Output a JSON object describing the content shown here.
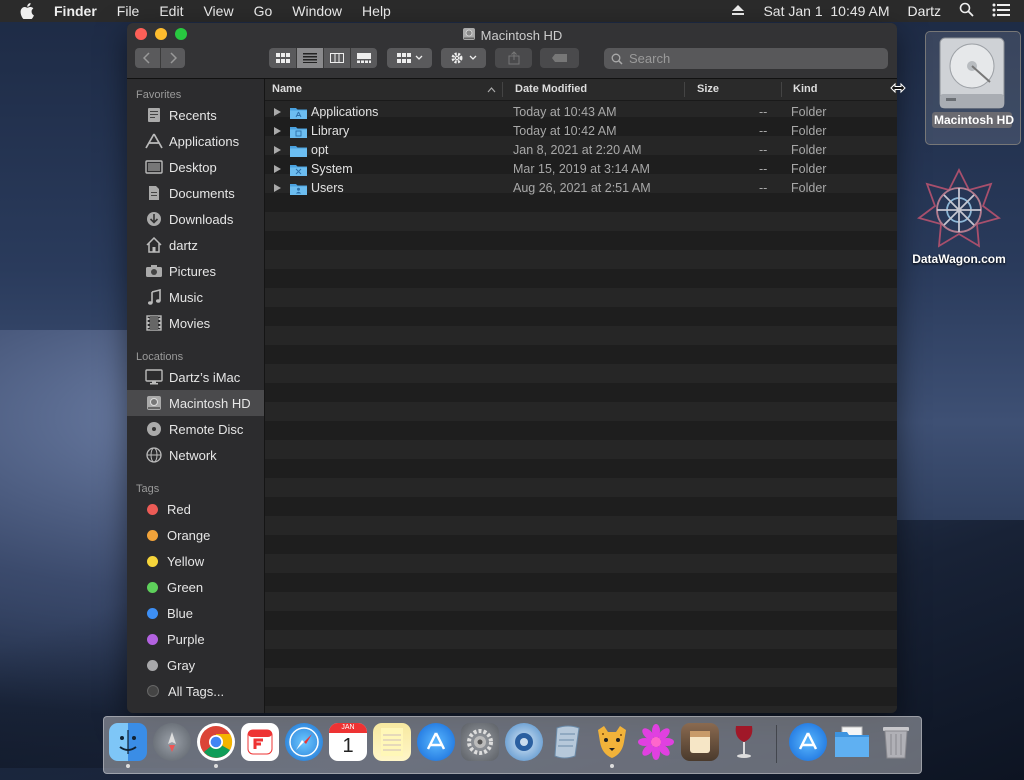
{
  "menubar": {
    "app_name": "Finder",
    "items": [
      "File",
      "Edit",
      "View",
      "Go",
      "Window",
      "Help"
    ],
    "datetime": "Sat Jan 1  10:49 AM",
    "user": "Dartz"
  },
  "window": {
    "title": "Macintosh HD",
    "search_placeholder": "Search"
  },
  "sidebar": {
    "favorites_header": "Favorites",
    "favorites": [
      {
        "label": "Recents",
        "icon": "clock-icon"
      },
      {
        "label": "Applications",
        "icon": "applications-icon"
      },
      {
        "label": "Desktop",
        "icon": "desktop-icon"
      },
      {
        "label": "Documents",
        "icon": "documents-icon"
      },
      {
        "label": "Downloads",
        "icon": "downloads-icon"
      },
      {
        "label": "dartz",
        "icon": "home-icon"
      },
      {
        "label": "Pictures",
        "icon": "camera-icon"
      },
      {
        "label": "Music",
        "icon": "music-note-icon"
      },
      {
        "label": "Movies",
        "icon": "film-icon"
      }
    ],
    "locations_header": "Locations",
    "locations": [
      {
        "label": "Dartz’s iMac",
        "icon": "imac-icon"
      },
      {
        "label": "Macintosh HD",
        "icon": "hard-drive-icon",
        "selected": true
      },
      {
        "label": "Remote Disc",
        "icon": "disc-icon"
      },
      {
        "label": "Network",
        "icon": "globe-icon"
      }
    ],
    "tags_header": "Tags",
    "tags": [
      {
        "label": "Red",
        "color": "#ec5b56"
      },
      {
        "label": "Orange",
        "color": "#f2a33a"
      },
      {
        "label": "Yellow",
        "color": "#f6d53b"
      },
      {
        "label": "Green",
        "color": "#5ed05b"
      },
      {
        "label": "Blue",
        "color": "#3d8ff5"
      },
      {
        "label": "Purple",
        "color": "#b362e0"
      },
      {
        "label": "Gray",
        "color": "#a8a8aa"
      },
      {
        "label": "All Tags...",
        "color": "#555"
      }
    ]
  },
  "columns": {
    "name": "Name",
    "date": "Date Modified",
    "size": "Size",
    "kind": "Kind"
  },
  "files": [
    {
      "name": "Applications",
      "date": "Today at 10:43 AM",
      "size": "--",
      "kind": "Folder"
    },
    {
      "name": "Library",
      "date": "Today at 10:42 AM",
      "size": "--",
      "kind": "Folder"
    },
    {
      "name": "opt",
      "date": "Jan 8, 2021 at 2:20 AM",
      "size": "--",
      "kind": "Folder"
    },
    {
      "name": "System",
      "date": "Mar 15, 2019 at 3:14 AM",
      "size": "--",
      "kind": "Folder"
    },
    {
      "name": "Users",
      "date": "Aug 26, 2021 at 2:51 AM",
      "size": "--",
      "kind": "Folder"
    }
  ],
  "desktop": {
    "hd_label": "Macintosh HD",
    "datawagon_label": "DataWagon.com"
  },
  "dock": {
    "calendar_month": "JAN",
    "calendar_day": "1",
    "apps": [
      "finder-icon",
      "launchpad-icon",
      "chrome-icon",
      "fantastical-icon",
      "safari-icon",
      "calendar-icon",
      "notes-icon",
      "app-store-icon",
      "system-preferences-icon",
      "utility-icon",
      "script-editor-icon",
      "cheetah-icon",
      "flower-app-icon",
      "terminal-icon",
      "wine-icon",
      "app-store-folder-icon",
      "downloads-stack-icon",
      "trash-icon"
    ]
  }
}
